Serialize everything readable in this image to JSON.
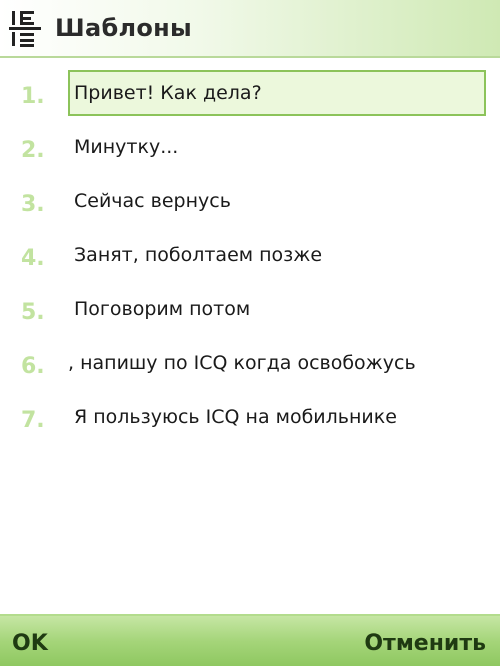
{
  "header": {
    "title": "Шаблоны",
    "icon": "templates-icon"
  },
  "templates": [
    {
      "number": "1.",
      "text": "Привет! Как дела?",
      "selected": true
    },
    {
      "number": "2.",
      "text": "Минутку..."
    },
    {
      "number": "3.",
      "text": "Сейчас вернусь"
    },
    {
      "number": "4.",
      "text": "Занят, поболтаем позже"
    },
    {
      "number": "5.",
      "text": "Поговорим потом"
    },
    {
      "number": "6.",
      "text": ", напишу по ICQ когда освобожусь"
    },
    {
      "number": "7.",
      "text": "Я пользуюсь ICQ на мобильнике"
    }
  ],
  "softkeys": {
    "left": "OK",
    "right": "Отменить"
  },
  "colors": {
    "accent": "#8cc35a",
    "number": "#c2e3a0",
    "softbar": "#a5d57a"
  }
}
